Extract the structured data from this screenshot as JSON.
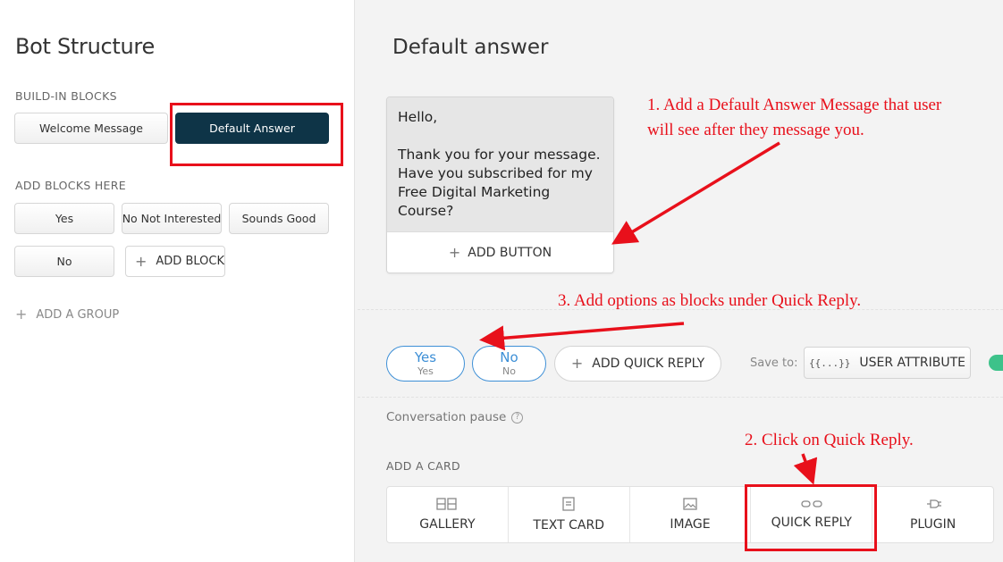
{
  "left": {
    "title": "Bot Structure",
    "build_in_label": "BUILD-IN BLOCKS",
    "build_in_blocks": [
      "Welcome Message",
      "Default Answer"
    ],
    "add_blocks_label": "ADD BLOCKS HERE",
    "blocks": [
      "Yes",
      "No Not Interested",
      "Sounds Good",
      "No"
    ],
    "add_block": "ADD BLOCK",
    "add_group": "ADD A GROUP"
  },
  "main": {
    "title": "Default answer",
    "message": "Hello,\n\nThank you for your message.\nHave you subscribed for my\nFree Digital Marketing Course?",
    "add_button": "ADD BUTTON",
    "quick_replies": [
      {
        "title": "Yes",
        "sub": "Yes"
      },
      {
        "title": "No",
        "sub": "No"
      }
    ],
    "add_quick_reply": "ADD QUICK REPLY",
    "save_to": "Save to:",
    "attr_icon": "{{...}}",
    "user_attribute": "USER ATTRIBUTE",
    "conversation_pause": "Conversation pause",
    "add_card_label": "ADD A CARD",
    "cards": [
      "GALLERY",
      "TEXT CARD",
      "IMAGE",
      "QUICK REPLY",
      "PLUGIN"
    ]
  },
  "annotations": {
    "note1": "1. Add a Default Answer Message that user\n will see after they message you.",
    "note2": "2. Click on Quick Reply.",
    "note3": "3. Add options as blocks under Quick Reply."
  },
  "colors": {
    "active_block": "#0e3447",
    "annotation_red": "#e8101b",
    "quick_reply_blue": "#3d8fd6",
    "toggle_green": "#3dc28a"
  }
}
